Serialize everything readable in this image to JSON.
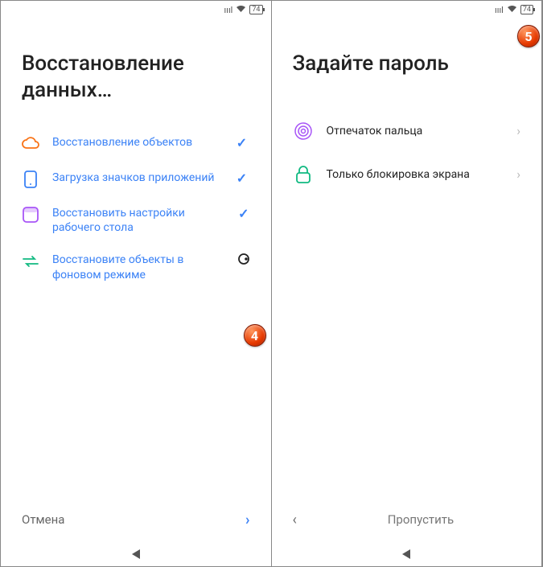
{
  "statusbar": {
    "battery": "74"
  },
  "screen1": {
    "title": "Восстановление данных…",
    "items": [
      {
        "label": "Восстановление объектов",
        "icon": "cloud",
        "status": "done"
      },
      {
        "label": "Загрузка значков приложений",
        "icon": "phone",
        "status": "done"
      },
      {
        "label": "Восстановить настройки рабочего стола",
        "icon": "layout",
        "status": "done"
      },
      {
        "label": "Восстановите объекты в фоновом режиме",
        "icon": "transfer",
        "status": "pending"
      }
    ],
    "footer": {
      "cancel": "Отмена"
    },
    "badge": "4"
  },
  "screen2": {
    "title": "Задайте пароль",
    "options": [
      {
        "label": "Отпечаток пальца",
        "icon": "fingerprint"
      },
      {
        "label": "Только блокировка экрана",
        "icon": "lock"
      }
    ],
    "footer": {
      "skip": "Пропустить"
    },
    "badge": "5"
  }
}
